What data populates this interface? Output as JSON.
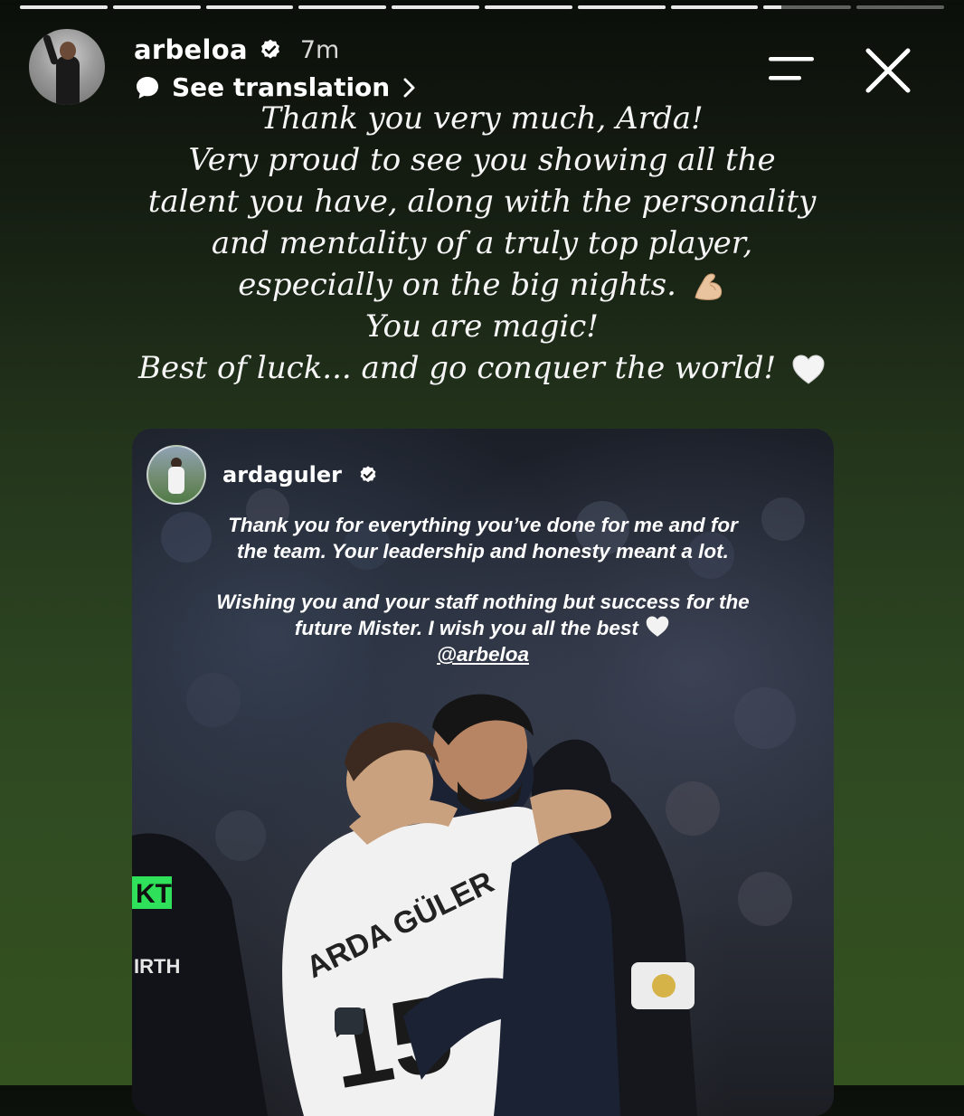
{
  "story": {
    "progress_segments": [
      1,
      1,
      1,
      1,
      1,
      1,
      1,
      1,
      0.2,
      0
    ],
    "username": "arbeloa",
    "timestamp": "7m",
    "translate_label": "See translation",
    "icons": {
      "verified": "verified-badge-icon",
      "translate": "speech-bubble-icon",
      "chevron": "chevron-right-icon",
      "menu": "menu-icon",
      "close": "close-icon"
    }
  },
  "message": {
    "lines": [
      "Thank you very much, Arda!",
      "Very proud to see you showing all the",
      "talent you have, along with the personality",
      "and mentality of a truly top player,",
      "especially on the big nights.",
      "You are magic!",
      "Best of luck... and go conquer the world!"
    ],
    "emojis": [
      "flexed-biceps-emoji",
      "white-heart-emoji"
    ]
  },
  "shared_story": {
    "username": "ardaguler",
    "paragraph1": [
      "Thank you for everything you’ve done for me and for",
      "the team. Your leadership and honesty meant a lot."
    ],
    "paragraph2": [
      "Wishing you and your staff nothing but success for the",
      "future Mister. I wish you all the best"
    ],
    "mention": "@arbeloa",
    "jersey_name": "ARDA GÜLER",
    "jersey_number": "15",
    "sponsor_fragment": "KT",
    "shirt_fragment": "IRTH"
  }
}
